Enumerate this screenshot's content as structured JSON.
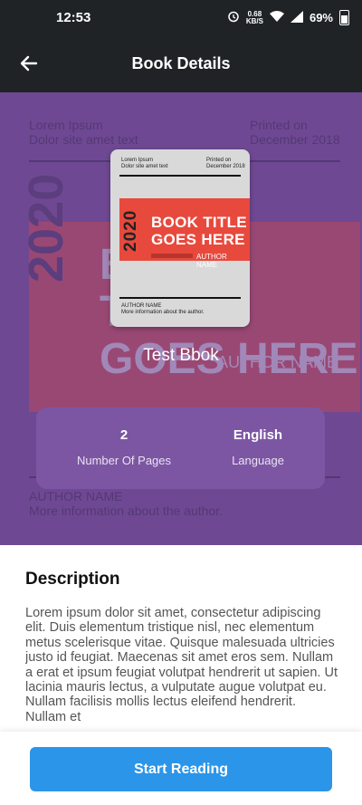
{
  "status_bar": {
    "time": "12:53",
    "net_speed_value": "0.68",
    "net_speed_unit": "KB/S",
    "battery": "69%"
  },
  "app_bar": {
    "title": "Book Details",
    "back_icon": "arrow-left-icon"
  },
  "cover": {
    "top_left_line1": "Lorem Ipsum",
    "top_left_line2": "Dolor site amet text",
    "top_right_line1": "Printed on",
    "top_right_line2": "December 2018",
    "year": "2020",
    "title_line1": "BOOK TITLE",
    "title_line2": "GOES HERE",
    "author_name": "AUTHOR NAME",
    "bottom_line1": "AUTHOR NAME",
    "bottom_line2": "More information about the author."
  },
  "book": {
    "title": "Test Bbok"
  },
  "stats": [
    {
      "value": "2",
      "label": "Number Of Pages"
    },
    {
      "value": "English",
      "label": "Language"
    }
  ],
  "description": {
    "heading": "Description",
    "body": "Lorem ipsum dolor sit amet, consectetur adipiscing elit. Duis elementum tristique nisl, nec elementum metus scelerisque vitae. Quisque malesuada ultricies justo id feugiat. Maecenas sit amet eros sem. Nullam a erat et ipsum feugiat volutpat hendrerit ut sapien. Ut lacinia mauris lectus, a vulputate augue volutpat eu. Nullam facilisis mollis lectus eleifend hendrerit. Nullam et"
  },
  "actions": {
    "start_reading": "Start Reading"
  },
  "colors": {
    "hero": "#6f4893",
    "accent_button": "#2b95e9",
    "cover_band": "#e8493d"
  }
}
